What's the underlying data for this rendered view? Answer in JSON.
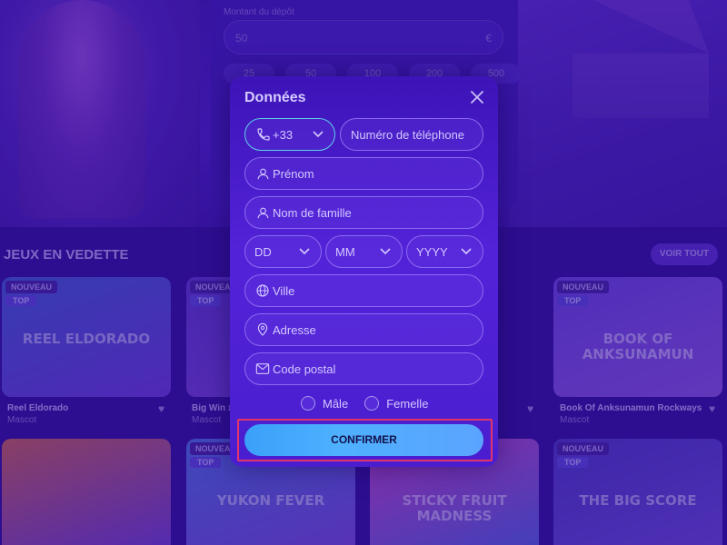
{
  "background": {
    "deposit": {
      "label": "Montant du dépôt",
      "value": "50",
      "currency": "€",
      "chips": [
        "25",
        "50",
        "100",
        "200",
        "500"
      ]
    },
    "section_title": "JEUX EN VEDETTE",
    "see_all": "VOIR TOUT",
    "games": [
      {
        "title": "Reel Eldorado",
        "provider": "Mascot",
        "badge_new": "NOUVEAU",
        "badge_top": "TOP",
        "art": "REEL ELDORADO",
        "color1": "#3c62c8",
        "color2": "#6a3fd0"
      },
      {
        "title": "Big Win x",
        "provider": "Mascot",
        "badge_new": "NOUVEAU",
        "badge_top": "TOP",
        "art": "",
        "color1": "#5a3ac0",
        "color2": "#7a48d0"
      },
      {
        "title": "Book Of Anksunamun Rockways",
        "provider": "Mascot",
        "badge_new": "NOUVEAU",
        "badge_top": "TOP",
        "art": "BOOK OF ANKSUNAMUN",
        "color1": "#6a4ad8",
        "color2": "#8a5ad8"
      },
      {
        "title": "",
        "provider": "",
        "badge_new": "",
        "badge_top": "",
        "art": "",
        "color1": "#d26a3a",
        "color2": "#6a3fd0"
      },
      {
        "title": "",
        "provider": "",
        "badge_new": "NOUVEAU",
        "badge_top": "TOP",
        "art": "YUKON FEVER",
        "color1": "#4a7ad8",
        "color2": "#7a4fd0"
      },
      {
        "title": "",
        "provider": "",
        "badge_new": "",
        "badge_top": "",
        "art": "STICKY FRUIT MADNESS",
        "color1": "#d04ab8",
        "color2": "#4a6ad8"
      },
      {
        "title": "",
        "provider": "",
        "badge_new": "NOUVEAU",
        "badge_top": "TOP",
        "art": "THE BIG SCORE",
        "color1": "#4a3ab8",
        "color2": "#6a4fd0"
      }
    ]
  },
  "modal": {
    "title": "Données",
    "phone_prefix": "+33",
    "phone_placeholder": "Numéro de téléphone",
    "first_name_placeholder": "Prénom",
    "last_name_placeholder": "Nom de famille",
    "day_placeholder": "DD",
    "month_placeholder": "MM",
    "year_placeholder": "YYYY",
    "city_placeholder": "Ville",
    "address_placeholder": "Adresse",
    "postal_placeholder": "Code postal",
    "gender_male": "Mâle",
    "gender_female": "Femelle",
    "confirm_label": "CONFIRMER"
  },
  "colors": {
    "modal_bg": "#4a1ecf",
    "confirm_bg": "#4fb0ff",
    "highlight_outline": "#e3356b",
    "page_bg": "#2a0f8a"
  }
}
